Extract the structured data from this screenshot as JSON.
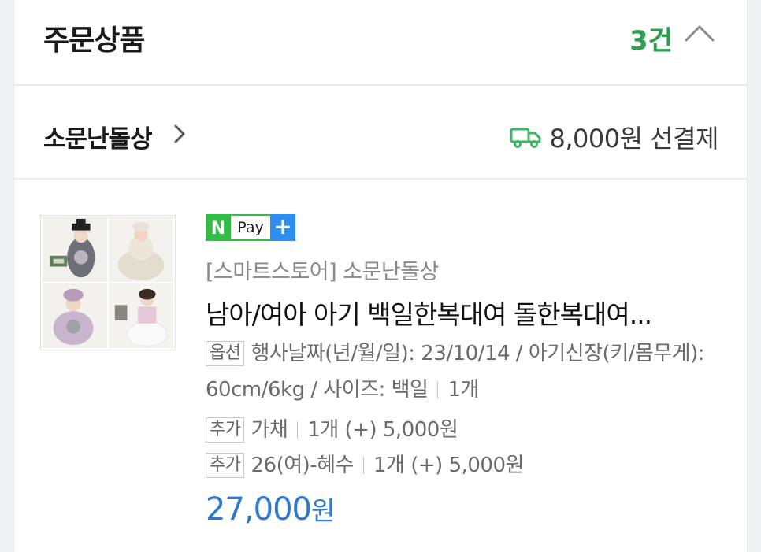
{
  "section": {
    "title": "주문상품",
    "count": "3건",
    "collapse_icon": "chevron-up-icon"
  },
  "store": {
    "name": "소문난돌상",
    "link_icon": "chevron-right-icon",
    "shipping_icon": "truck-icon",
    "shipping": "8,000원 선결제"
  },
  "product": {
    "badge": {
      "n": "N",
      "pay": "Pay",
      "plus": "+"
    },
    "seller": "[스마트스토어] 소문난돌상",
    "name": "남아/여아 아기 백일한복대여 돌한복대여...",
    "option": {
      "tag": "옵션",
      "text": "행사날짜(년/월/일): 23/10/14 / 아기신장(키/몸무게): 60cm/6kg / 사이즈: 백일",
      "qty": "1개"
    },
    "extras": [
      {
        "tag": "추가",
        "name": "가채",
        "detail": "1개 (+) 5,000원"
      },
      {
        "tag": "추가",
        "name": "26(여)-혜수",
        "detail": "1개 (+) 5,000원"
      }
    ],
    "price": "27,000",
    "price_unit": "원"
  },
  "colors": {
    "accent_green": "#2f9e4f",
    "npay_green": "#2fbd44",
    "price_blue": "#2e78d1"
  }
}
